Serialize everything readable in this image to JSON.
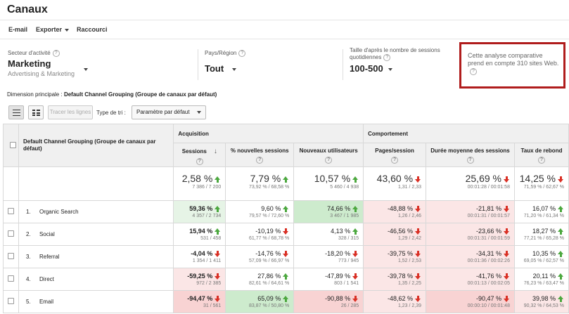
{
  "page": {
    "title": "Canaux"
  },
  "toolbar": {
    "email": "E-mail",
    "exporter": "Exporter",
    "raccourci": "Raccourci"
  },
  "benchmark": {
    "sector": {
      "label": "Secteur d'activité",
      "value": "Marketing",
      "sub": "Advertising & Marketing"
    },
    "country": {
      "label": "Pays/Région",
      "value": "Tout"
    },
    "size": {
      "label1": "Taille d'après le nombre de sessions",
      "label2": "quotidiennes",
      "value": "100-500"
    },
    "note": "Cette analyse comparative prend en compte 310 sites Web."
  },
  "dimension": {
    "label": "Dimension principale :",
    "value": "Default Channel Grouping (Groupe de canaux par défaut)"
  },
  "controls": {
    "plot_rows": "Tracer les lignes",
    "sort_label": "Type de tri :",
    "sort_value": "Paramètre par défaut"
  },
  "table": {
    "dim_header": "Default Channel Grouping (Groupe de canaux par défaut)",
    "groups": {
      "acquisition": "Acquisition",
      "behavior": "Comportement"
    },
    "metrics": [
      "Sessions",
      "% nouvelles sessions",
      "Nouveaux utilisateurs",
      "Pages/session",
      "Durée moyenne des sessions",
      "Taux de rebond"
    ],
    "totals": [
      {
        "pct": "2,58 %",
        "sub": "7 386 / 7 200",
        "dir": "up"
      },
      {
        "pct": "7,79 %",
        "sub": "73,92 % / 68,58 %",
        "dir": "up"
      },
      {
        "pct": "10,57 %",
        "sub": "5 460 / 4 938",
        "dir": "up"
      },
      {
        "pct": "43,60 %",
        "sub": "1,31 / 2,33",
        "dir": "down"
      },
      {
        "pct": "25,69 %",
        "sub": "00:01:28 / 00:01:58",
        "dir": "down"
      },
      {
        "pct": "14,25 %",
        "sub": "71,59 % / 62,67 %",
        "dir": "down"
      }
    ],
    "rows": [
      {
        "num": "1.",
        "name": "Organic Search",
        "cells": [
          {
            "pct": "59,36 %",
            "sub": "4 357 / 2 734",
            "dir": "up",
            "cls": "pos"
          },
          {
            "pct": "9,60 %",
            "sub": "79,57 % / 72,60 %",
            "dir": "up",
            "cls": ""
          },
          {
            "pct": "74,66 %",
            "sub": "3 467 / 1 985",
            "dir": "up",
            "cls": "pos2"
          },
          {
            "pct": "-48,88 %",
            "sub": "1,26 / 2,46",
            "dir": "down",
            "cls": "neg"
          },
          {
            "pct": "-21,81 %",
            "sub": "00:01:31 / 00:01:57",
            "dir": "down",
            "cls": "neg"
          },
          {
            "pct": "16,07 %",
            "sub": "71,20 % / 61,34 %",
            "dir": "up",
            "cls": ""
          }
        ]
      },
      {
        "num": "2.",
        "name": "Social",
        "cells": [
          {
            "pct": "15,94 %",
            "sub": "531 / 458",
            "dir": "up",
            "cls": ""
          },
          {
            "pct": "-10,19 %",
            "sub": "61,77 % / 68,78 %",
            "dir": "down",
            "cls": ""
          },
          {
            "pct": "4,13 %",
            "sub": "328 / 315",
            "dir": "up",
            "cls": ""
          },
          {
            "pct": "-46,56 %",
            "sub": "1,29 / 2,42",
            "dir": "down",
            "cls": "neg"
          },
          {
            "pct": "-23,66 %",
            "sub": "00:01:31 / 00:01:59",
            "dir": "down",
            "cls": "neg"
          },
          {
            "pct": "18,27 %",
            "sub": "77,21 % / 65,28 %",
            "dir": "up",
            "cls": ""
          }
        ]
      },
      {
        "num": "3.",
        "name": "Referral",
        "cells": [
          {
            "pct": "-4,04 %",
            "sub": "1 354 / 1 411",
            "dir": "down",
            "cls": ""
          },
          {
            "pct": "-14,76 %",
            "sub": "57,09 % / 66,97 %",
            "dir": "down",
            "cls": ""
          },
          {
            "pct": "-18,20 %",
            "sub": "773 / 945",
            "dir": "down",
            "cls": ""
          },
          {
            "pct": "-39,75 %",
            "sub": "1,52 / 2,53",
            "dir": "down",
            "cls": "neg"
          },
          {
            "pct": "-34,31 %",
            "sub": "00:01:36 / 00:02:26",
            "dir": "down",
            "cls": "neg"
          },
          {
            "pct": "10,35 %",
            "sub": "69,05 % / 62,57 %",
            "dir": "up",
            "cls": ""
          }
        ]
      },
      {
        "num": "4.",
        "name": "Direct",
        "cells": [
          {
            "pct": "-59,25 %",
            "sub": "972 / 2 385",
            "dir": "down",
            "cls": "neg"
          },
          {
            "pct": "27,86 %",
            "sub": "82,61 % / 64,61 %",
            "dir": "up",
            "cls": ""
          },
          {
            "pct": "-47,89 %",
            "sub": "803 / 1 541",
            "dir": "down",
            "cls": ""
          },
          {
            "pct": "-39,78 %",
            "sub": "1,35 / 2,25",
            "dir": "down",
            "cls": "neg"
          },
          {
            "pct": "-41,76 %",
            "sub": "00:01:13 / 00:02:05",
            "dir": "down",
            "cls": "neg"
          },
          {
            "pct": "20,11 %",
            "sub": "76,23 % / 63,47 %",
            "dir": "up",
            "cls": ""
          }
        ]
      },
      {
        "num": "5.",
        "name": "Email",
        "cells": [
          {
            "pct": "-94,47 %",
            "sub": "31 / 561",
            "dir": "down",
            "cls": "neg2"
          },
          {
            "pct": "65,09 %",
            "sub": "83,87 % / 50,80 %",
            "dir": "up",
            "cls": "pos2"
          },
          {
            "pct": "-90,88 %",
            "sub": "26 / 285",
            "dir": "down",
            "cls": "neg2"
          },
          {
            "pct": "-48,62 %",
            "sub": "1,23 / 2,39",
            "dir": "down",
            "cls": "neg"
          },
          {
            "pct": "-90,47 %",
            "sub": "00:00:10 / 00:01:48",
            "dir": "down",
            "cls": "neg2"
          },
          {
            "pct": "39,98 %",
            "sub": "90,32 % / 64,53 %",
            "dir": "up",
            "cls": "neg"
          }
        ]
      }
    ]
  }
}
